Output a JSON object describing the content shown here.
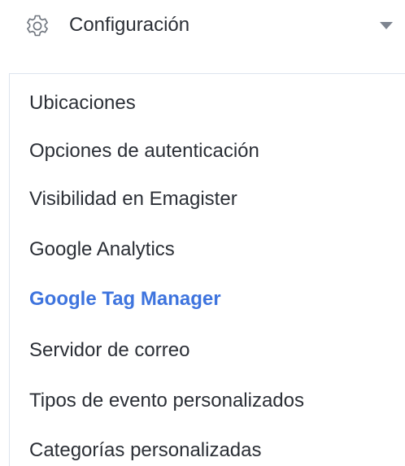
{
  "header": {
    "icon": "gear-icon",
    "label": "Configuración",
    "expanded_icon": "caret-down-icon"
  },
  "submenu": {
    "active_color": "#3e74de",
    "items": [
      {
        "label": "Ubicaciones",
        "active": false
      },
      {
        "label": "Opciones de autenticación",
        "active": false
      },
      {
        "label": "Visibilidad en Emagister",
        "active": false
      },
      {
        "label": "Google Analytics",
        "active": false
      },
      {
        "label": "Google Tag Manager",
        "active": true
      },
      {
        "label": "Servidor de correo",
        "active": false
      },
      {
        "label": "Tipos de evento personalizados",
        "active": false
      },
      {
        "label": "Categorías personalizadas",
        "active": false
      }
    ]
  }
}
